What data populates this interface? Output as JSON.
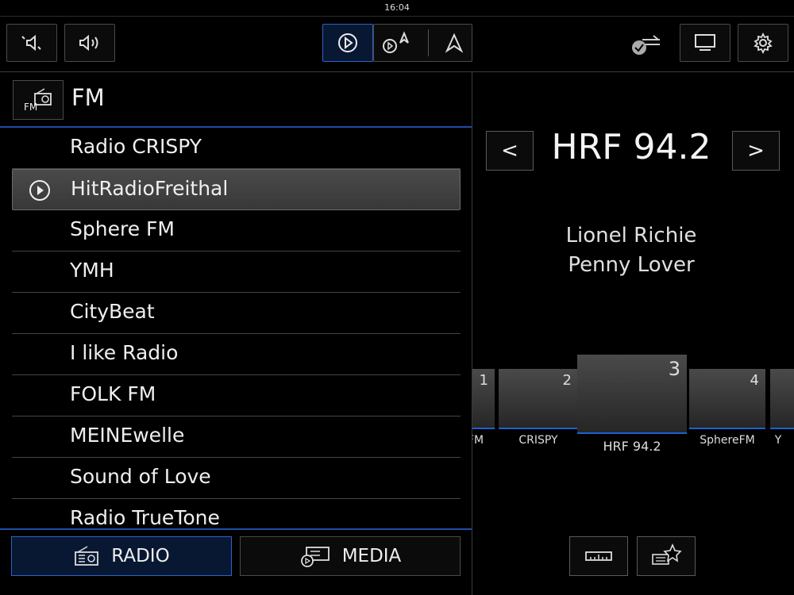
{
  "status": {
    "time": "16:04"
  },
  "source": {
    "title": "FM",
    "icon_label": "FM"
  },
  "stations": [
    "Radio CRISPY",
    "HitRadioFreithal",
    "Sphere FM",
    "YMH",
    "CityBeat",
    "I like Radio",
    "FOLK FM",
    "MEINEwelle",
    "Sound of Love",
    "Radio TrueTone"
  ],
  "selected_station_index": 1,
  "now_playing": {
    "station": "HRF 94.2",
    "artist": "Lionel Richie",
    "title": "Penny Lover",
    "prev_label": "<",
    "next_label": ">"
  },
  "presets": [
    {
      "num": "1",
      "label": "FM"
    },
    {
      "num": "2",
      "label": "CRISPY"
    },
    {
      "num": "3",
      "label": "HRF 94.2"
    },
    {
      "num": "4",
      "label": "SphereFM"
    },
    {
      "num": "",
      "label": "Y"
    }
  ],
  "bottom": {
    "radio_label": "RADIO",
    "media_label": "MEDIA"
  },
  "colors": {
    "accent": "#1f5fd0",
    "active_bg": "#081833"
  },
  "icons": [
    "volume-down-icon",
    "volume-up-icon",
    "play-circle-icon",
    "media-nav-icon",
    "navigation-arrow-icon",
    "connection-check-icon",
    "screen-icon",
    "gear-icon",
    "fm-radio-icon",
    "radio-icon",
    "media-icon",
    "tuner-scale-icon",
    "favorite-star-icon"
  ]
}
